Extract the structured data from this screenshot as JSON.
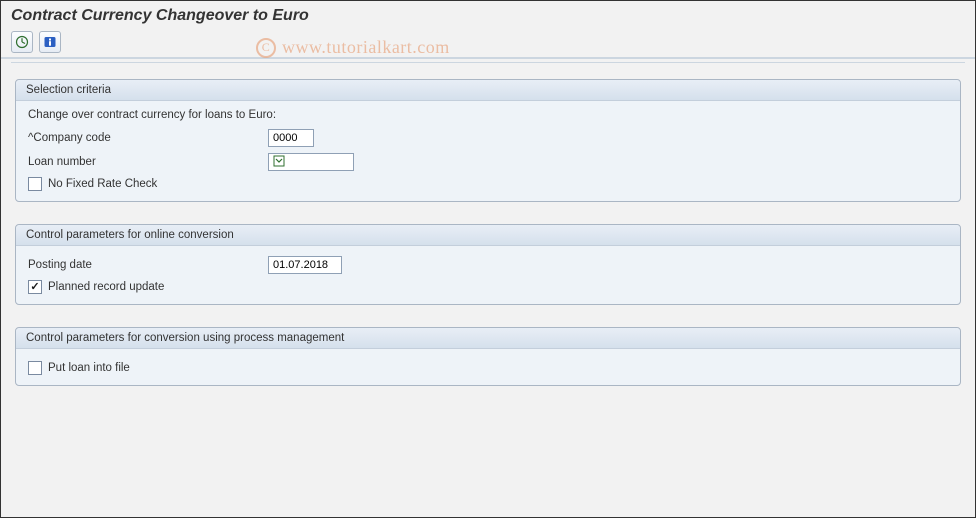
{
  "title": "Contract Currency Changeover to Euro",
  "watermark": "www.tutorialkart.com",
  "toolbar": {
    "executeTip": "Execute",
    "infoTip": "Information"
  },
  "group1": {
    "title": "Selection criteria",
    "subtitle": "Change over contract currency for loans to Euro:",
    "companyLabel": "^Company code",
    "companyValue": "0000",
    "loanLabel": "Loan number",
    "loanValue": "",
    "noFixedRateLabel": "No Fixed Rate Check",
    "noFixedRateChecked": false
  },
  "group2": {
    "title": "Control parameters for online conversion",
    "postingDateLabel": "Posting date",
    "postingDateValue": "01.07.2018",
    "plannedUpdateLabel": "Planned record update",
    "plannedUpdateChecked": true
  },
  "group3": {
    "title": "Control parameters for conversion using process management",
    "putLoanLabel": "Put loan into file",
    "putLoanChecked": false
  }
}
